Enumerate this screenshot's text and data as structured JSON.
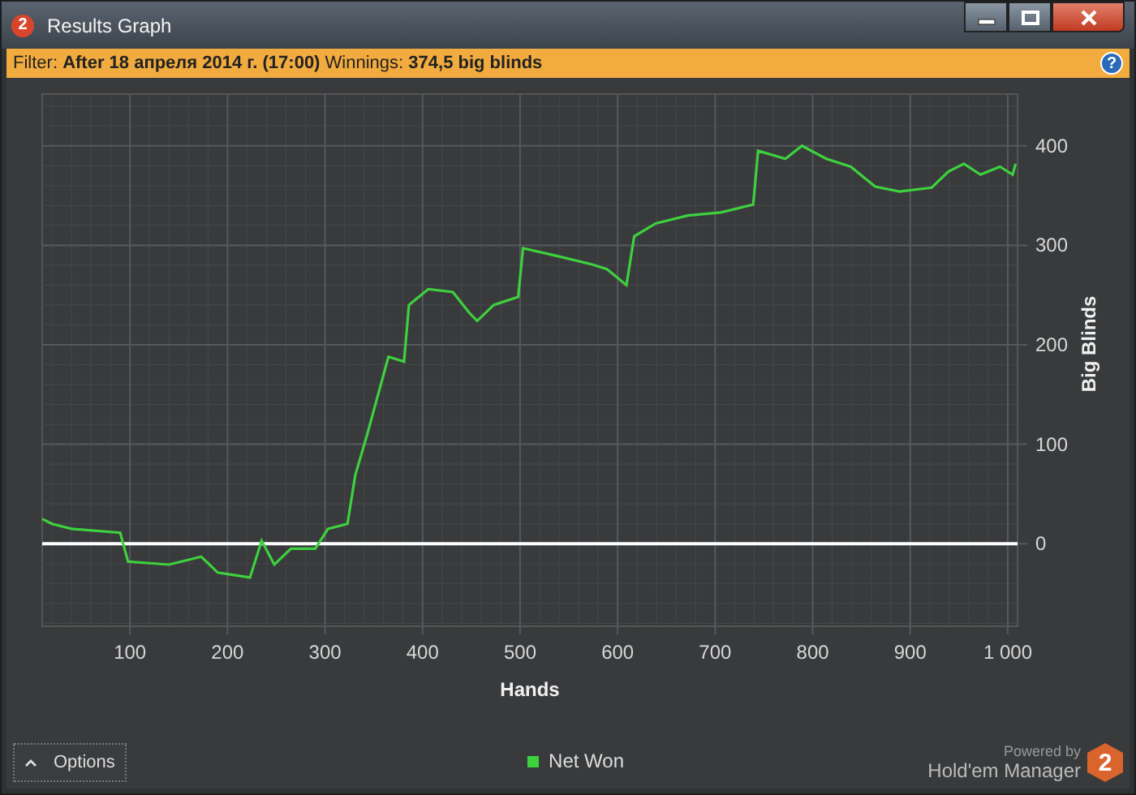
{
  "window": {
    "title": "Results Graph",
    "app_icon_text": "2"
  },
  "filter_bar": {
    "text": "Filter: **After 18 апреля 2014 г. (17:00)** Winnings: **374,5 big blinds**",
    "help_button": "?"
  },
  "graph": {
    "chart_data": {
      "type": "line",
      "xlabel": "Hands",
      "ylabel": "Big Blinds",
      "xlim": [
        10,
        1010
      ],
      "ylim": [
        -83,
        452
      ],
      "xticks": [
        100,
        200,
        300,
        400,
        500,
        600,
        700,
        800,
        900,
        {
          "value": 1000,
          "label": "1 000"
        }
      ],
      "yticks": [
        0,
        100,
        200,
        300,
        400
      ],
      "x": [
        10,
        20,
        40,
        90,
        98,
        140,
        173,
        190,
        223,
        235,
        248,
        265,
        290,
        303,
        323,
        331,
        343,
        365,
        381,
        386,
        406,
        431,
        448,
        456,
        473,
        498,
        503,
        539,
        573,
        589,
        609,
        617,
        639,
        672,
        706,
        739,
        744,
        772,
        789,
        814,
        839,
        864,
        889,
        922,
        939,
        955,
        972,
        992,
        1005,
        1008
      ],
      "series": [
        {
          "name": "Net Won",
          "color": "#3ed13e",
          "values": [
            25,
            20,
            15,
            11,
            -18,
            -21,
            -13,
            -29,
            -34,
            3,
            -21,
            -5,
            -5,
            15,
            20,
            69,
            109,
            188,
            183,
            240,
            256,
            253,
            232,
            224,
            240,
            248,
            297,
            289,
            281,
            276,
            260,
            309,
            322,
            330,
            333,
            341,
            395,
            387,
            400,
            387,
            379,
            359,
            354,
            358,
            374,
            382,
            371,
            379,
            371,
            382
          ]
        }
      ],
      "grid": true,
      "ref_lines": [
        {
          "axis": "y",
          "value": 0,
          "color": "#ffffff"
        }
      ]
    }
  },
  "footer": {
    "options_button": "Options",
    "powered_by": "Powered by",
    "brand": "Hold'em Manager",
    "brand_logo_text": "2"
  }
}
